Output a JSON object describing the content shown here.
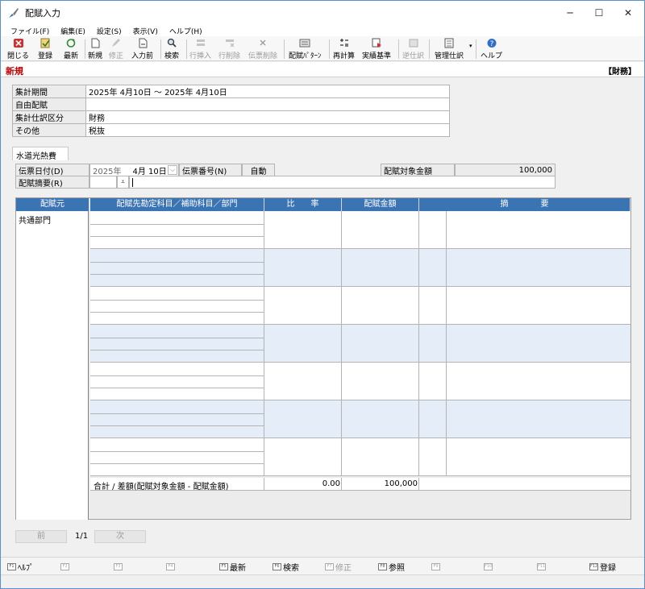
{
  "window": {
    "title": "配賦入力",
    "minimize": "─",
    "maximize": "☐",
    "close": "✕"
  },
  "menu": [
    "ファイル(F)",
    "編集(E)",
    "設定(S)",
    "表示(V)",
    "ヘルプ(H)"
  ],
  "toolbar": {
    "close": "閉じる",
    "register": "登録",
    "refresh": "最新",
    "new": "新規",
    "modify": "修正",
    "input_prev": "入力前",
    "search": "検索",
    "row_insert": "行挿入",
    "row_delete": "行削除",
    "slip_delete": "伝票削除",
    "pattern": "配賦ﾊﾟﾀｰﾝ",
    "recalc": "再計算",
    "actual_basis": "実績基準",
    "reverse_journal": "逆仕訳",
    "mgmt_journal": "管理仕訳",
    "help": "ヘルプ"
  },
  "mode": {
    "status": "新規",
    "category": "【財務】"
  },
  "info": {
    "period_label": "集計期間",
    "period_value": "2025年 4月10日 ～ 2025年 4月10日",
    "free_label": "自由配賦",
    "free_value": "",
    "class_label": "集計仕訳区分",
    "class_value": "財務",
    "other_label": "その他",
    "other_value": "税抜"
  },
  "section": {
    "tab": "水道光熱費"
  },
  "slip": {
    "date_label": "伝票日付(D)",
    "date_year": "2025年",
    "date_md": "4月 10日",
    "number_label": "伝票番号(N)",
    "number_value": "自動",
    "target_label": "配賦対象金額",
    "target_value": "100,000",
    "summary_label": "配賦摘要(R)",
    "summary_value": ""
  },
  "grid": {
    "headers": {
      "source": "配賦元",
      "dest": "配賦先勘定科目／補助科目／部門",
      "ratio": "比　　率",
      "amount": "配賦金額",
      "memo": "摘　　　　要"
    },
    "source_value": "共通部門",
    "total_label": "合計 / 差額(配賦対象金額 - 配賦金額)",
    "total_ratio": "0.00",
    "total_amount": "100,000"
  },
  "pager": {
    "prev": "前",
    "page": "1/1",
    "next": "次"
  },
  "fkeys": [
    {
      "key": "F1",
      "label": "ﾍﾙﾌﾟ",
      "enabled": true
    },
    {
      "key": "F2",
      "label": "",
      "enabled": false
    },
    {
      "key": "F3",
      "label": "",
      "enabled": false
    },
    {
      "key": "F4",
      "label": "",
      "enabled": false
    },
    {
      "key": "F5",
      "label": "最新",
      "enabled": true
    },
    {
      "key": "F6",
      "label": "検索",
      "enabled": true
    },
    {
      "key": "F7",
      "label": "修正",
      "enabled": false
    },
    {
      "key": "F8",
      "label": "参照",
      "enabled": true
    },
    {
      "key": "F9",
      "label": "",
      "enabled": false
    },
    {
      "key": "F10",
      "label": "",
      "enabled": false
    },
    {
      "key": "F11",
      "label": "",
      "enabled": false
    },
    {
      "key": "F12",
      "label": "登録",
      "enabled": true
    }
  ]
}
